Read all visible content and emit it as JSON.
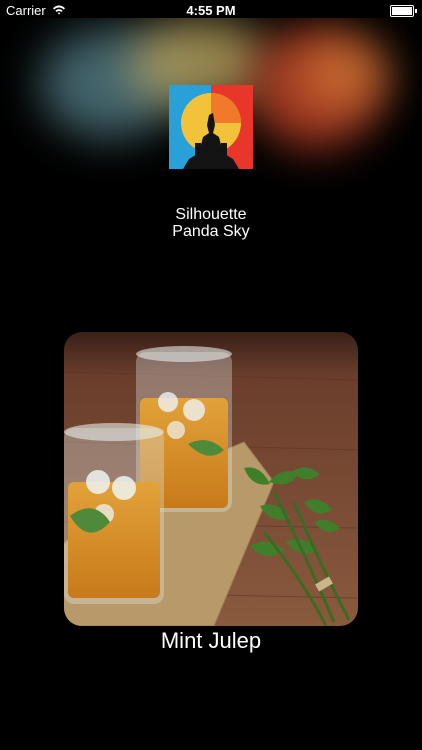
{
  "status_bar": {
    "carrier": "Carrier",
    "time": "4:55 PM",
    "wifi_icon": "wifi-icon",
    "battery_icon": "battery-icon"
  },
  "now_playing": {
    "song_title": "Silhouette",
    "artist": "Panda Sky",
    "art_icon": "silhouette-album-art"
  },
  "featured": {
    "title": "Mint Julep",
    "image": "mint-julep-photo"
  },
  "colors": {
    "background": "#000000",
    "text": "#ffffff"
  }
}
